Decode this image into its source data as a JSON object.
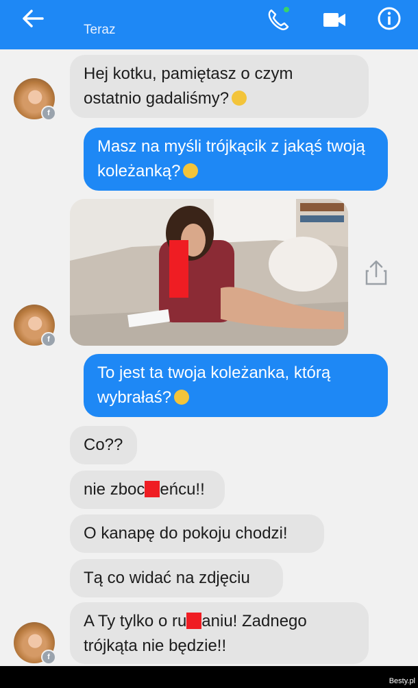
{
  "header": {
    "status": "Teraz",
    "icons": [
      "back-arrow-icon",
      "phone-icon",
      "video-camera-icon",
      "info-icon"
    ]
  },
  "colors": {
    "accent": "#1e88f5",
    "incoming_bubble": "#e4e4e4",
    "censor": "#ef1d23"
  },
  "messages": [
    {
      "from": "contact",
      "text": "Hej kotku, pamiętasz o czym ostatnio gadaliśmy?"
    },
    {
      "from": "me",
      "text": "Masz na myśli trójkącik z jakąś twoją koleżanką?"
    },
    {
      "from": "contact",
      "type": "photo"
    },
    {
      "from": "me",
      "text": "To jest ta twoja koleżanka, którą wybrałaś?"
    },
    {
      "from": "contact",
      "text": "Co??"
    },
    {
      "from": "contact",
      "text_before": "nie zboc",
      "text_after": "eńcu!!"
    },
    {
      "from": "contact",
      "text": "O kanapę do pokoju chodzi!"
    },
    {
      "from": "contact",
      "text": "Tą co widać na zdjęciu"
    },
    {
      "from": "contact",
      "text_before": "A Ty tylko o ru",
      "text_after": "aniu! Zadnego trójkąta nie będzie!!"
    }
  ],
  "watermark": "Besty.pl"
}
